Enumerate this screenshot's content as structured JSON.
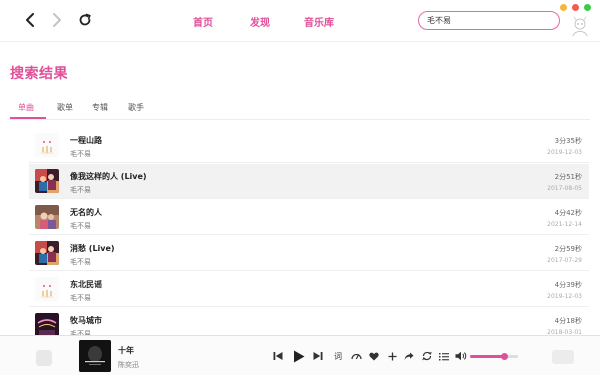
{
  "nav": {
    "back_icon": "chevron-left-icon",
    "forward_icon": "chevron-right-icon",
    "refresh_icon": "refresh-icon",
    "links": [
      {
        "label": "首页"
      },
      {
        "label": "发现"
      },
      {
        "label": "音乐库"
      }
    ],
    "search_value": "毛不易",
    "window_dots": [
      "#f5b53f",
      "#f05b58",
      "#3ec94b"
    ]
  },
  "colors": {
    "accent": "#e0509a"
  },
  "page": {
    "title": "搜索结果",
    "tabs": [
      {
        "label": "单曲",
        "active": true
      },
      {
        "label": "歌单",
        "active": false
      },
      {
        "label": "专辑",
        "active": false
      },
      {
        "label": "歌手",
        "active": false
      }
    ]
  },
  "songs": [
    {
      "title": "一程山路",
      "artist": "毛不易",
      "duration": "3分35秒",
      "date": "2019-12-03",
      "cover": "light-sketch",
      "highlighted": false
    },
    {
      "title": "像我这样的人 (Live)",
      "artist": "毛不易",
      "duration": "2分51秒",
      "date": "2017-08-05",
      "cover": "stage-photo",
      "highlighted": true
    },
    {
      "title": "无名的人",
      "artist": "毛不易",
      "duration": "4分42秒",
      "date": "2021-12-14",
      "cover": "portrait-photo",
      "highlighted": false
    },
    {
      "title": "消愁 (Live)",
      "artist": "毛不易",
      "duration": "2分59秒",
      "date": "2017-07-29",
      "cover": "stage-photo",
      "highlighted": false
    },
    {
      "title": "东北民谣",
      "artist": "毛不易",
      "duration": "4分39秒",
      "date": "2019-12-03",
      "cover": "light-sketch",
      "highlighted": false
    },
    {
      "title": "牧马城市",
      "artist": "毛不易",
      "duration": "4分18秒",
      "date": "2018-03-01",
      "cover": "dark-album",
      "highlighted": false
    }
  ],
  "player": {
    "title": "十年",
    "artist": "陈奕迅",
    "lyrics_label": "词",
    "icons": [
      "previous-icon",
      "play-icon",
      "next-icon",
      "lyrics-icon",
      "speed-icon",
      "heart-icon",
      "add-icon",
      "share-icon",
      "repeat-icon",
      "playlist-icon",
      "volume-icon"
    ],
    "volume": 0.72
  }
}
